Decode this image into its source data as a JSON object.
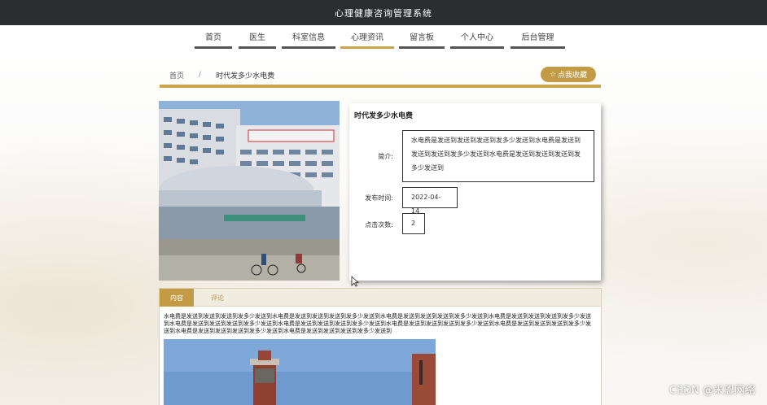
{
  "app": {
    "title": "心理健康咨询管理系统"
  },
  "nav": {
    "items": [
      {
        "label": "首页"
      },
      {
        "label": "医生"
      },
      {
        "label": "科室信息"
      },
      {
        "label": "心理资讯"
      },
      {
        "label": "留言板"
      },
      {
        "label": "个人中心"
      },
      {
        "label": "后台管理"
      }
    ],
    "active": "心理资讯"
  },
  "breadcrumb": {
    "home": "首页",
    "separator": "/",
    "current": "时代发多少水电费"
  },
  "collect_button": {
    "label": "点我收藏",
    "icon": "star-outline-icon"
  },
  "article": {
    "title": "时代发多少水电费",
    "summary_label": "简介:",
    "summary": "水电费是发送到发送到发送到发多少发送到水电费是发送到发送到发送到发多少发送到水电费是发送到发送到发送到发多少发送到",
    "publish_label": "发布时间:",
    "publish_date": "2022-04-14",
    "clicks_label": "点击次数:",
    "clicks": "2"
  },
  "content": {
    "tabs": [
      {
        "label": "内容"
      },
      {
        "label": "评论"
      }
    ],
    "body": "水电费是发送到发送到发送到发多少发送到水电费是发送到发送到发送到发多少发送到水电费是发送到发送到发送到发多少发送到水电费是发送到发送到发送到发多少发送到水电费是发送到发送到发送到发多少发送到水电费是发送到发送到发送到发多少发送到水电费是发送到发送到发送到发多少发送到水电费是发送到发送到发送到发多少发送到水电费是发送到发送到发送到发多少发送到水电费是发送到发送到发送到发多少发送到"
  },
  "watermark": "CSDN @米恩网络",
  "colors": {
    "accent": "#c39b45",
    "topbar": "#2b2d31",
    "nav_underline": "#555555"
  }
}
